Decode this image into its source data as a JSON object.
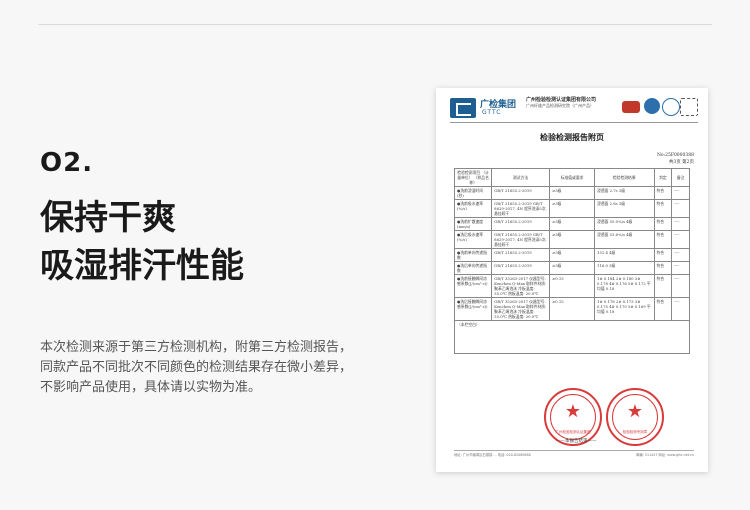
{
  "section": {
    "number": "O2.",
    "heading_lines": [
      "保持干爽",
      "吸湿排汗性能"
    ],
    "description_lines": [
      "本次检测来源于第三方检测机构，附第三方检测报告，",
      "同款产品不同批次不同颜色的检测结果存在微小差异，",
      "不影响产品使用，具体请以实物为准。"
    ]
  },
  "report": {
    "brand": "广检集团",
    "brand_en": "GTTC",
    "institute_name": "广州检验检测认证集团有限公司",
    "institute_sub": "广州纤维产品检测研究院（广州产品）",
    "title": "检验检测报告附页",
    "report_no": "No:25F0000388",
    "page": "共3页 第2页",
    "columns": [
      "检验检测项目 （计量单位） （样品名称）",
      "测试方法",
      "标准值或要求",
      "检验检测结果",
      "判定",
      "备注"
    ],
    "rows": [
      [
        "●洗前浸湿时间(秒)",
        "GB/T 21655.2-2019",
        "≥3级",
        "浸透面 2.7s 3级",
        "符合",
        "----"
      ],
      [
        "●洗前吸水速率(%/s)",
        "GB/T 21655.2-2019 GB/T 8629-2017, 4N 程序洗涤5次, 悬挂晾干",
        "≥3级",
        "浸透面 2.8s 3级",
        "符合",
        "----"
      ],
      [
        "●洗前扩散速度(mm/s)",
        "GB/T 21655.2-2019",
        "≥3级",
        "浸透面 55.0%/s 4级",
        "符合",
        "----"
      ],
      [
        "●洗后吸水速率(%/s)",
        "GB/T 21655.2-2019 GB/T 8629-2017, 4N 程序洗涤5次, 悬挂晾干",
        "≥3级",
        "浸透面 53.6%/s 4级",
        "符合",
        "----"
      ],
      [
        "●洗前单向传递指数",
        "GB/T 21655.2-2019",
        "≥3级",
        "151.4 4级",
        "符合",
        "----"
      ],
      [
        "●洗后单向传递指数",
        "GB/T 21655.2-2019",
        "≥3级",
        "116.0 3级",
        "符合",
        "----"
      ],
      [
        "●洗前接触瞬间凉感系数(J/(cm²·s))",
        "GB/T 35263-2017 仪器型号: Kenchen Q-Max 取样件材质: 聚苯乙烯泡沫 冷板温度: 35.0℃ 热板温度: 20.0℃",
        "≥0.15",
        "1# 0.184 2# 0.180 3# 0.178 4# 0.176 5# 0.172 平均值 0.18",
        "符合",
        "----"
      ],
      [
        "●洗后接触瞬间凉感系数(J/(cm²·s))",
        "GB/T 35263-2017 仪器型号: Kenchen Q-Max 取样件材质: 聚苯乙烯泡沫 冷板温度: 35.0℃ 热板温度: 20.0℃",
        "≥0.15",
        "1# 0.178 2# 0.173 3# 0.175 4# 0.170 5# 0.169 平均值 0.18",
        "符合",
        "----"
      ]
    ],
    "blank_label": "（本栏空白）",
    "end_text": "——本报告结束——",
    "stamp1_text": "广州检验检测认证集团",
    "stamp2_text": "检验检测专用章",
    "footer_left": "地址: 广州市番禺区石楼镇 ... 电话: 020-82069888",
    "footer_right": "邮编: 511447 网址: www.gttc.net.cn"
  },
  "colors": {
    "stamp": "#d93a3a",
    "brand": "#1d5f93"
  },
  "icons": [
    "gttc-logo-icon",
    "cma-mark-icon",
    "ilac-mac-mark-icon",
    "cnas-mark-icon",
    "qr-code-icon",
    "star-icon"
  ]
}
